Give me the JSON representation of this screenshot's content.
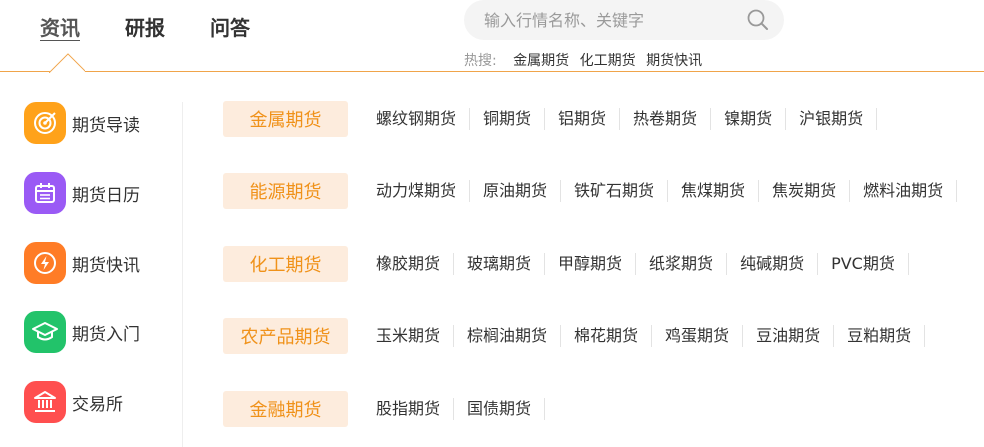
{
  "tabs": [
    {
      "label": "资讯",
      "active": true
    },
    {
      "label": "研报",
      "active": false
    },
    {
      "label": "问答",
      "active": false
    }
  ],
  "search": {
    "placeholder": "输入行情名称、关键字"
  },
  "hot": {
    "label": "热搜:",
    "links": [
      "金属期货",
      "化工期货",
      "期货快讯"
    ]
  },
  "sidebar": {
    "items": [
      {
        "label": "期货导读",
        "icon": "target-icon",
        "color": "#ffa21a"
      },
      {
        "label": "期货日历",
        "icon": "calendar-icon",
        "color": "#9a5af5"
      },
      {
        "label": "期货快讯",
        "icon": "lightning-icon",
        "color": "#ff7c26"
      },
      {
        "label": "期货入门",
        "icon": "graduation-cap-icon",
        "color": "#22c36a"
      },
      {
        "label": "交易所",
        "icon": "bank-icon",
        "color": "#ff4f4f"
      }
    ]
  },
  "categories": [
    {
      "label": "金属期货",
      "items": [
        "螺纹钢期货",
        "铜期货",
        "铝期货",
        "热卷期货",
        "镍期货",
        "沪银期货"
      ]
    },
    {
      "label": "能源期货",
      "items": [
        "动力煤期货",
        "原油期货",
        "铁矿石期货",
        "焦煤期货",
        "焦炭期货",
        "燃料油期货"
      ]
    },
    {
      "label": "化工期货",
      "items": [
        "橡胶期货",
        "玻璃期货",
        "甲醇期货",
        "纸浆期货",
        "纯碱期货",
        "PVC期货"
      ]
    },
    {
      "label": "农产品期货",
      "items": [
        "玉米期货",
        "棕榈油期货",
        "棉花期货",
        "鸡蛋期货",
        "豆油期货",
        "豆粕期货"
      ]
    },
    {
      "label": "金融期货",
      "items": [
        "股指期货",
        "国债期货"
      ]
    }
  ],
  "colors": {
    "accent": "#f0921a",
    "badge_bg": "#fdecdd",
    "divider": "#f0a44a"
  }
}
